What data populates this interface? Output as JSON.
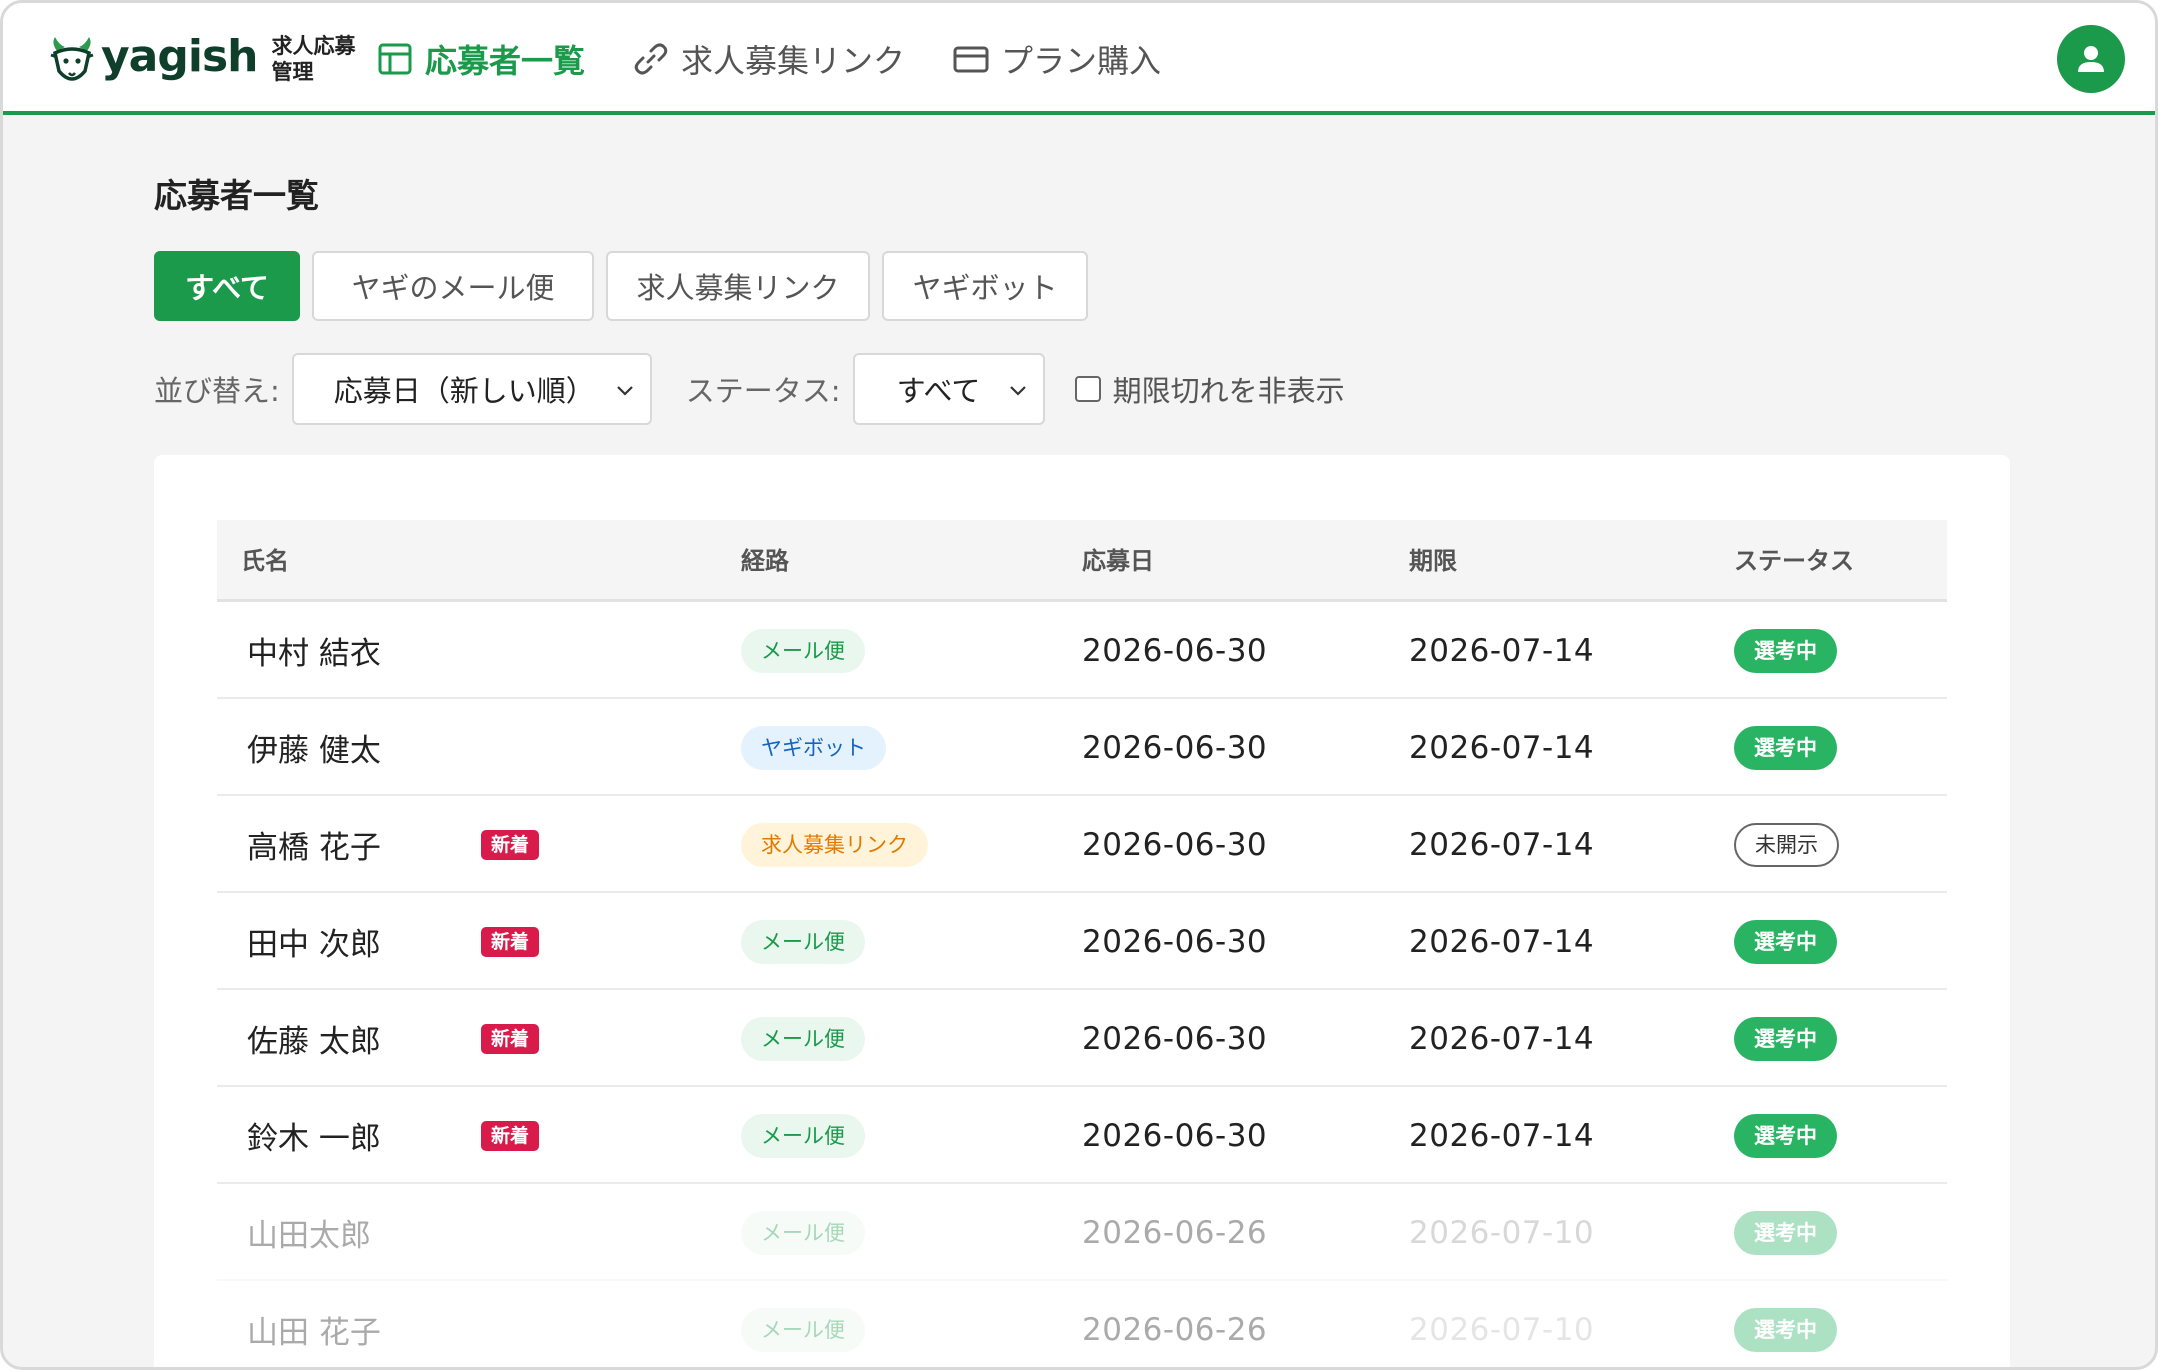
{
  "app": {
    "logo_text": "yagish",
    "logo_sub": "求人応募管理"
  },
  "nav": {
    "items": [
      {
        "label": "応募者一覧",
        "icon": "layout-icon",
        "active": true
      },
      {
        "label": "求人募集リンク",
        "icon": "link-icon",
        "active": false
      },
      {
        "label": "プラン購入",
        "icon": "credit-card-icon",
        "active": false
      }
    ]
  },
  "page": {
    "title": "応募者一覧"
  },
  "tabs": [
    {
      "label": "すべて",
      "active": true
    },
    {
      "label": "ヤギのメール便",
      "active": false
    },
    {
      "label": "求人募集リンク",
      "active": false
    },
    {
      "label": "ヤギボット",
      "active": false
    }
  ],
  "filters": {
    "sort_label": "並び替え:",
    "sort_value": "応募日（新しい順）",
    "status_label": "ステータス:",
    "status_value": "すべて",
    "hide_expired_label": "期限切れを非表示",
    "hide_expired_checked": false
  },
  "table": {
    "headers": {
      "name": "氏名",
      "route": "経路",
      "applied": "応募日",
      "due": "期限",
      "status": "ステータス"
    },
    "new_badge": "新着",
    "rows": [
      {
        "name": "中村 結衣",
        "is_new": false,
        "route": "メール便",
        "route_type": "mail",
        "applied": "2026-06-30",
        "due": "2026-07-14",
        "status": "選考中",
        "status_type": "sel",
        "faded": false
      },
      {
        "name": "伊藤 健太",
        "is_new": false,
        "route": "ヤギボット",
        "route_type": "bot",
        "applied": "2026-06-30",
        "due": "2026-07-14",
        "status": "選考中",
        "status_type": "sel",
        "faded": false
      },
      {
        "name": "高橋 花子",
        "is_new": true,
        "route": "求人募集リンク",
        "route_type": "link",
        "applied": "2026-06-30",
        "due": "2026-07-14",
        "status": "未開示",
        "status_type": "unopened",
        "faded": false
      },
      {
        "name": "田中 次郎",
        "is_new": true,
        "route": "メール便",
        "route_type": "mail",
        "applied": "2026-06-30",
        "due": "2026-07-14",
        "status": "選考中",
        "status_type": "sel",
        "faded": false
      },
      {
        "name": "佐藤 太郎",
        "is_new": true,
        "route": "メール便",
        "route_type": "mail",
        "applied": "2026-06-30",
        "due": "2026-07-14",
        "status": "選考中",
        "status_type": "sel",
        "faded": false
      },
      {
        "name": "鈴木 一郎",
        "is_new": true,
        "route": "メール便",
        "route_type": "mail",
        "applied": "2026-06-30",
        "due": "2026-07-14",
        "status": "選考中",
        "status_type": "sel",
        "faded": false
      },
      {
        "name": "山田太郎",
        "is_new": false,
        "route": "メール便",
        "route_type": "mail",
        "applied": "2026-06-26",
        "due": "2026-07-10",
        "status": "選考中",
        "status_type": "sel",
        "faded": true
      },
      {
        "name": "山田 花子",
        "is_new": false,
        "route": "メール便",
        "route_type": "mail",
        "applied": "2026-06-26",
        "due": "2026-07-10",
        "status": "選考中",
        "status_type": "sel",
        "faded": true
      }
    ]
  },
  "colors": {
    "brand": "#1a9a4a",
    "new_badge": "#d81b4a",
    "status_selecting": "#28b463"
  }
}
